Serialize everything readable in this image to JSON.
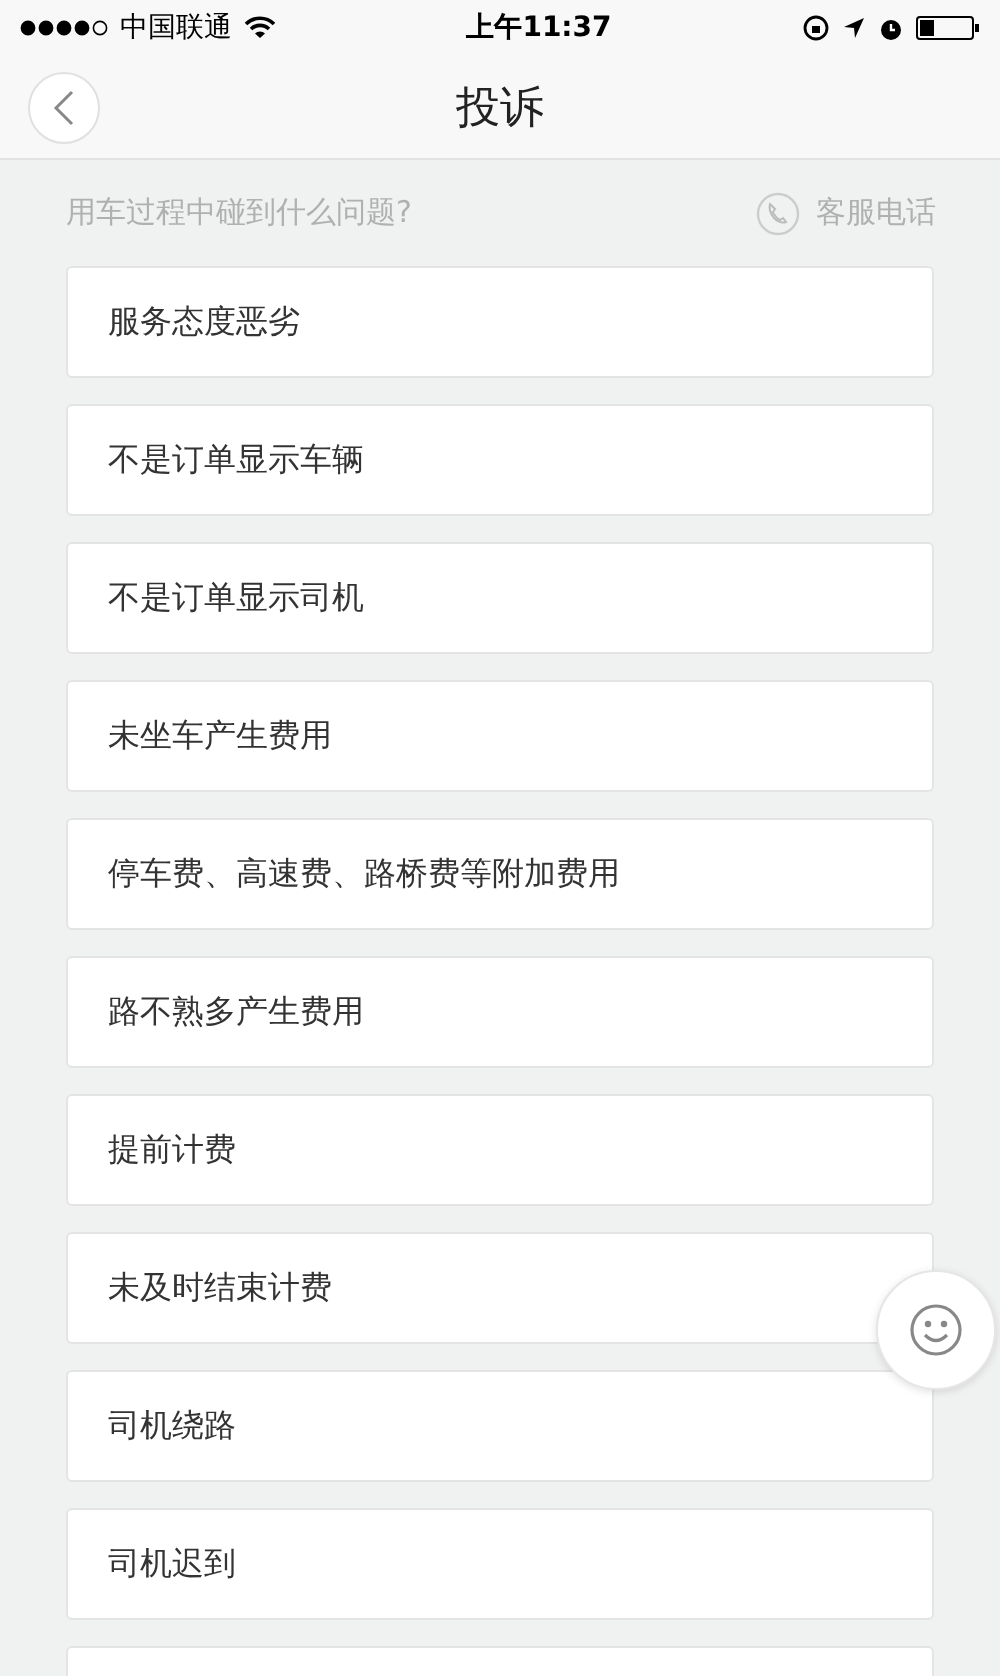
{
  "status_bar": {
    "carrier": "中国联通",
    "time": "上午11:37"
  },
  "nav": {
    "title": "投诉"
  },
  "hint": {
    "question": "用车过程中碰到什么问题?",
    "service": "客服电话"
  },
  "items": [
    {
      "label": "服务态度恶劣"
    },
    {
      "label": "不是订单显示车辆"
    },
    {
      "label": "不是订单显示司机"
    },
    {
      "label": "未坐车产生费用"
    },
    {
      "label": "停车费、高速费、路桥费等附加费用"
    },
    {
      "label": "路不熟多产生费用"
    },
    {
      "label": "提前计费"
    },
    {
      "label": "未及时结束计费"
    },
    {
      "label": "司机绕路"
    },
    {
      "label": "司机迟到"
    }
  ]
}
